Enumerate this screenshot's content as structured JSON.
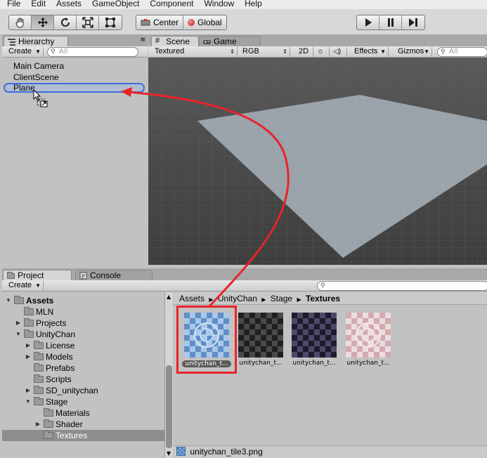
{
  "menu": [
    "File",
    "Edit",
    "Assets",
    "GameObject",
    "Component",
    "Window",
    "Help"
  ],
  "toolbar": {
    "tools": [
      "hand-tool-icon",
      "move-tool-icon",
      "rotate-tool-icon",
      "scale-tool-icon",
      "rect-tool-icon"
    ],
    "pivot": {
      "center_label": "Center",
      "global_label": "Global"
    },
    "playback": [
      "play-icon",
      "pause-icon",
      "step-icon"
    ]
  },
  "hierarchy": {
    "tab_label": "Hierarchy",
    "create_label": "Create",
    "search_placeholder": "All",
    "items": [
      "Main Camera",
      "ClientScene",
      "Plane"
    ]
  },
  "scene": {
    "tabs": [
      "Scene",
      "Game"
    ],
    "shading_mode": "Textured",
    "render_mode": "RGB",
    "toggle_2d": "2D",
    "effects_label": "Effects",
    "gizmos_label": "Gizmos",
    "search_placeholder": "All",
    "colors": {
      "background": "#3f3f3f",
      "plane": "#9aa2aa",
      "grid": "#6a6a6a"
    }
  },
  "project": {
    "tabs": [
      "Project",
      "Console"
    ],
    "create_label": "Create",
    "tree": [
      {
        "label": "Assets",
        "depth": 0,
        "expanded": true,
        "bold": true
      },
      {
        "label": "MLN",
        "depth": 1,
        "expanded": null
      },
      {
        "label": "Projects",
        "depth": 1,
        "expanded": false
      },
      {
        "label": "UnityChan",
        "depth": 1,
        "expanded": true
      },
      {
        "label": "License",
        "depth": 2,
        "expanded": false
      },
      {
        "label": "Models",
        "depth": 2,
        "expanded": false
      },
      {
        "label": "Prefabs",
        "depth": 2,
        "expanded": null
      },
      {
        "label": "Scripts",
        "depth": 2,
        "expanded": null
      },
      {
        "label": "SD_unitychan",
        "depth": 2,
        "expanded": false
      },
      {
        "label": "Stage",
        "depth": 2,
        "expanded": true
      },
      {
        "label": "Materials",
        "depth": 3,
        "expanded": null
      },
      {
        "label": "Shader",
        "depth": 3,
        "expanded": false
      },
      {
        "label": "Textures",
        "depth": 3,
        "expanded": null,
        "selected": true
      }
    ],
    "breadcrumb": [
      "Assets",
      "UnityChan",
      "Stage",
      "Textures"
    ],
    "assets": [
      {
        "label": "unitychan_t...",
        "style": "blue",
        "selected": true
      },
      {
        "label": "unitychan_t...",
        "style": "dark"
      },
      {
        "label": "unitychan_t...",
        "style": "purple"
      },
      {
        "label": "unitychan_t...",
        "style": "pink"
      }
    ],
    "status_file": "unitychan_tile3.png"
  },
  "annotation": {
    "colors": {
      "drag_arrow": "#e8242a",
      "selection_box": "#e8242a",
      "drop_target_outline": "#3a6fe0"
    }
  }
}
